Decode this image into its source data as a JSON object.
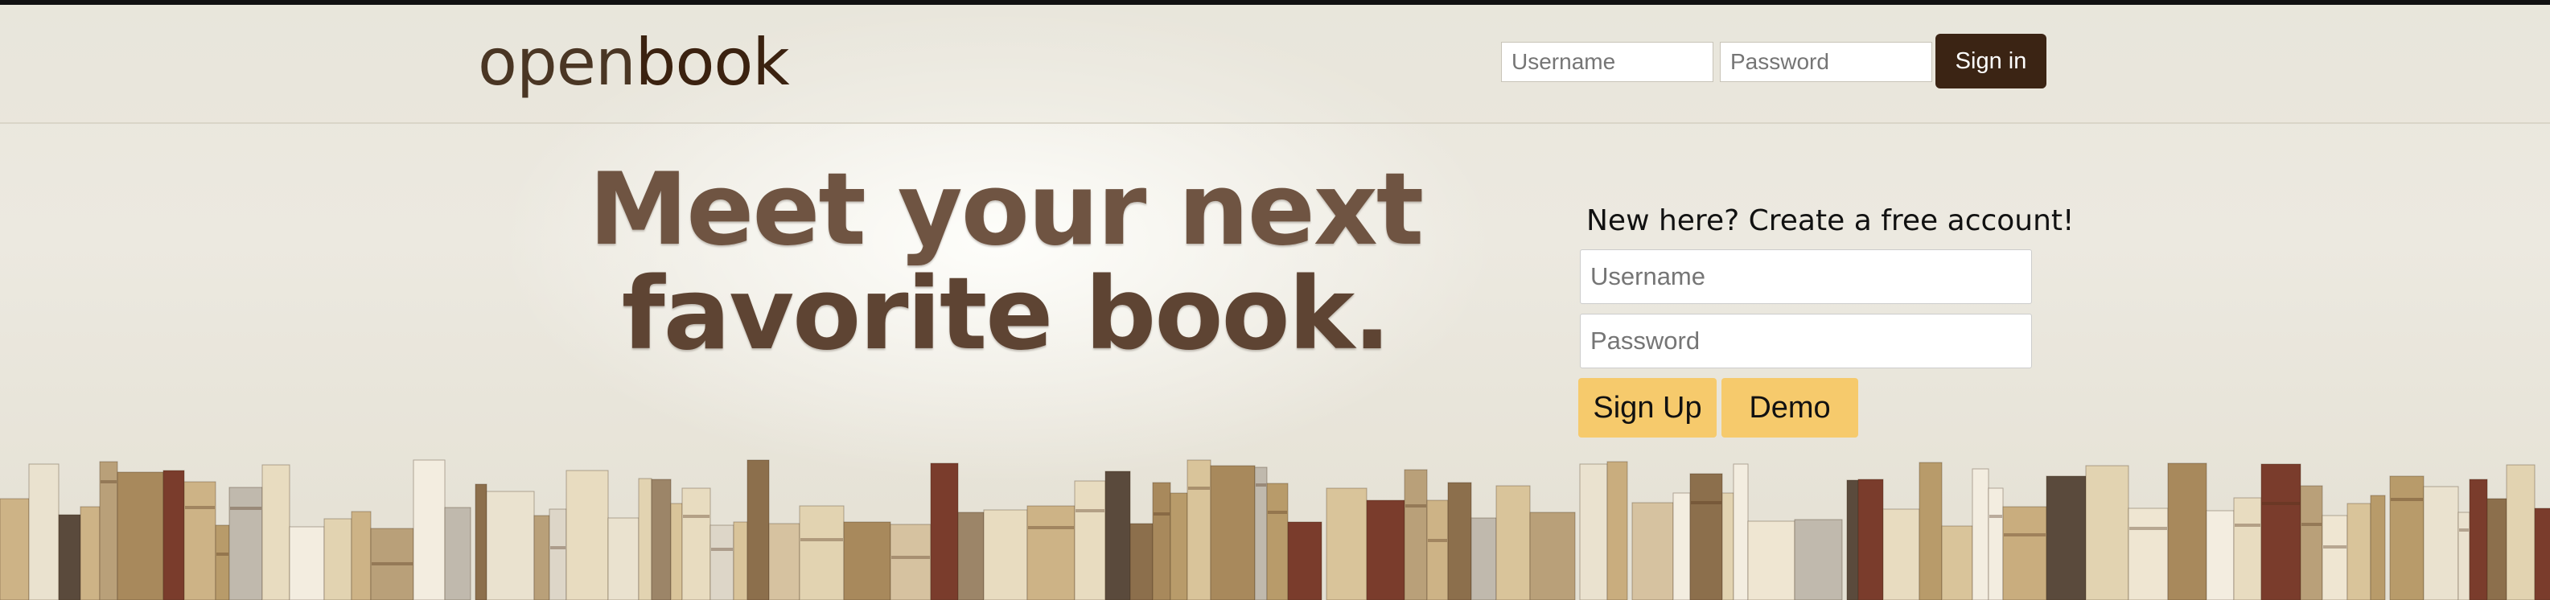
{
  "header": {
    "logo_light": "open",
    "logo_bold": "book",
    "login": {
      "username_placeholder": "Username",
      "password_placeholder": "Password",
      "signin_label": "Sign in"
    }
  },
  "hero": {
    "headline_line1": "Meet your next",
    "headline_line2": "favorite book."
  },
  "signup": {
    "title": "New here? Create a free account!",
    "username_placeholder": "Username",
    "password_placeholder": "Password",
    "signup_label": "Sign Up",
    "demo_label": "Demo"
  },
  "colors": {
    "brand_dark": "#3b2414",
    "accent_button": "#f6ca6c",
    "headline": "#6f5442"
  }
}
